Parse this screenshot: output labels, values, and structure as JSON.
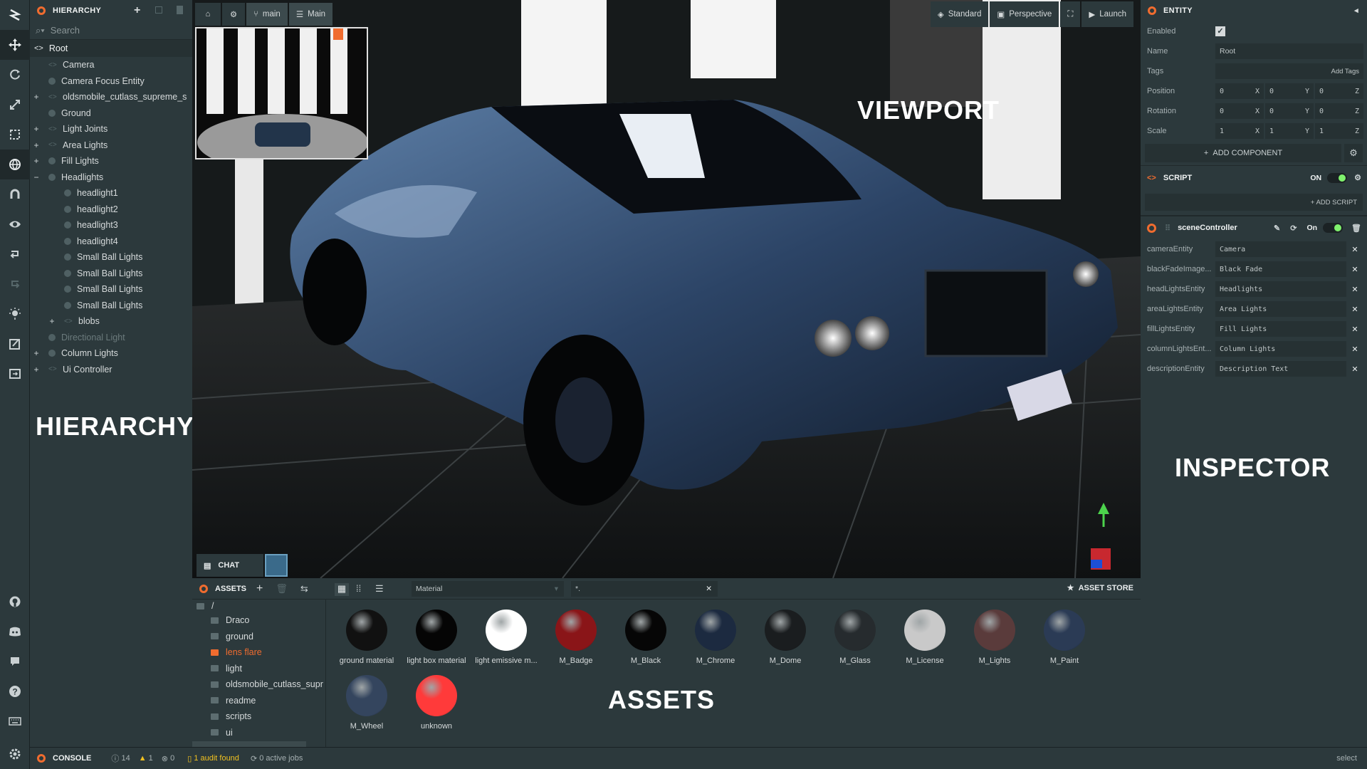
{
  "hierarchy": {
    "title": "HIERARCHY",
    "search_placeholder": "Search",
    "root": "Root",
    "items": [
      {
        "label": "Camera",
        "expander": "",
        "icon": "link",
        "depth": 1,
        "dim": false
      },
      {
        "label": "Camera Focus Entity",
        "expander": "",
        "icon": "dot",
        "depth": 1,
        "dim": false
      },
      {
        "label": "oldsmobile_cutlass_supreme_s",
        "expander": "+",
        "icon": "link",
        "depth": 1,
        "dim": false
      },
      {
        "label": "Ground",
        "expander": "",
        "icon": "dot",
        "depth": 1,
        "dim": false
      },
      {
        "label": "Light Joints",
        "expander": "+",
        "icon": "link",
        "depth": 1,
        "dim": false
      },
      {
        "label": "Area Lights",
        "expander": "+",
        "icon": "link",
        "depth": 1,
        "dim": false
      },
      {
        "label": "Fill Lights",
        "expander": "+",
        "icon": "dot",
        "depth": 1,
        "dim": false
      },
      {
        "label": "Headlights",
        "expander": "−",
        "icon": "dot",
        "depth": 1,
        "dim": false
      },
      {
        "label": "headlight1",
        "expander": "",
        "icon": "dot",
        "depth": 2,
        "dim": false
      },
      {
        "label": "headlight2",
        "expander": "",
        "icon": "dot",
        "depth": 2,
        "dim": false
      },
      {
        "label": "headlight3",
        "expander": "",
        "icon": "dot",
        "depth": 2,
        "dim": false
      },
      {
        "label": "headlight4",
        "expander": "",
        "icon": "dot",
        "depth": 2,
        "dim": false
      },
      {
        "label": "Small Ball Lights",
        "expander": "",
        "icon": "dot",
        "depth": 2,
        "dim": false
      },
      {
        "label": "Small Ball Lights",
        "expander": "",
        "icon": "dot",
        "depth": 2,
        "dim": false
      },
      {
        "label": "Small Ball Lights",
        "expander": "",
        "icon": "dot",
        "depth": 2,
        "dim": false
      },
      {
        "label": "Small Ball Lights",
        "expander": "",
        "icon": "dot",
        "depth": 2,
        "dim": false
      },
      {
        "label": "blobs",
        "expander": "+",
        "icon": "link",
        "depth": 2,
        "dim": false
      },
      {
        "label": "Directional Light",
        "expander": "",
        "icon": "dot",
        "depth": 1,
        "dim": true
      },
      {
        "label": "Column Lights",
        "expander": "+",
        "icon": "dot",
        "depth": 1,
        "dim": false
      },
      {
        "label": "Ui Controller",
        "expander": "+",
        "icon": "link",
        "depth": 1,
        "dim": false
      }
    ],
    "overlay_label": "HIERARCHY"
  },
  "viewport": {
    "branch": "main",
    "scene": "Main",
    "render_mode": "Standard",
    "camera": "Perspective",
    "launch": "Launch",
    "overlay_label": "VIEWPORT",
    "chat": "CHAT"
  },
  "inspector": {
    "title": "ENTITY",
    "enabled_label": "Enabled",
    "name_label": "Name",
    "name_value": "Root",
    "tags_label": "Tags",
    "add_tags": "Add Tags",
    "position_label": "Position",
    "rotation_label": "Rotation",
    "scale_label": "Scale",
    "position": [
      "0",
      "0",
      "0"
    ],
    "rotation": [
      "0",
      "0",
      "0"
    ],
    "scale": [
      "1",
      "1",
      "1"
    ],
    "axes": [
      "X",
      "Y",
      "Z"
    ],
    "add_component": "ADD COMPONENT",
    "script_title": "SCRIPT",
    "script_on": "ON",
    "add_script": "+ ADD SCRIPT",
    "script_name": "sceneController",
    "script_state": "On",
    "attributes": [
      {
        "label": "cameraEntity",
        "value": "Camera"
      },
      {
        "label": "blackFadeImage...",
        "value": "Black Fade"
      },
      {
        "label": "headLightsEntity",
        "value": "Headlights"
      },
      {
        "label": "areaLightsEntity",
        "value": "Area Lights"
      },
      {
        "label": "fillLightsEntity",
        "value": "Fill Lights"
      },
      {
        "label": "columnLightsEnt...",
        "value": "Column Lights"
      },
      {
        "label": "descriptionEntity",
        "value": "Description Text"
      }
    ],
    "overlay_label": "INSPECTOR"
  },
  "assets": {
    "title": "ASSETS",
    "path": "/",
    "filter_type": "Material",
    "filter_search": "*.",
    "asset_store": "ASSET STORE",
    "overlay_label": "ASSETS",
    "folders": [
      {
        "label": "Draco",
        "active": false
      },
      {
        "label": "ground",
        "active": false
      },
      {
        "label": "lens flare",
        "active": true
      },
      {
        "label": "light",
        "active": false
      },
      {
        "label": "oldsmobile_cutlass_supr",
        "active": false
      },
      {
        "label": "readme",
        "active": false
      },
      {
        "label": "scripts",
        "active": false
      },
      {
        "label": "ui",
        "active": false
      }
    ],
    "items": [
      {
        "label": "ground material",
        "color": "#111111"
      },
      {
        "label": "light box material",
        "color": "#050505"
      },
      {
        "label": "light emissive m...",
        "color": "#ffffff"
      },
      {
        "label": "M_Badge",
        "color": "#8a1518"
      },
      {
        "label": "M_Black",
        "color": "#060606"
      },
      {
        "label": "M_Chrome",
        "color": "#1c2a40"
      },
      {
        "label": "M_Dome",
        "color": "#1a1d1f"
      },
      {
        "label": "M_Glass",
        "color": "#262b2e"
      },
      {
        "label": "M_License",
        "color": "#c9c9c9"
      },
      {
        "label": "M_Lights",
        "color": "#5a3b3b"
      },
      {
        "label": "M_Paint",
        "color": "#2b3b55"
      },
      {
        "label": "M_Wheel",
        "color": "#34455e"
      },
      {
        "label": "unknown",
        "color": "#ff3a3a"
      }
    ]
  },
  "statusbar": {
    "console": "CONSOLE",
    "info_count": "14",
    "warn_count": "1",
    "error_count": "0",
    "audit": "1 audit found",
    "jobs": "0 active jobs",
    "mode": "select"
  },
  "colors": {
    "accent": "#f06c2f",
    "toggle_on": "#7ff26d",
    "panel": "#2c393c",
    "background": "#20292b"
  }
}
